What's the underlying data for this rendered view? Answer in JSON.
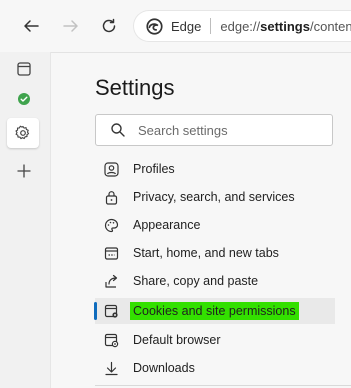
{
  "browser": {
    "brand": "Edge",
    "url_prefix": "edge://",
    "url_bold": "settings",
    "url_suffix": "/content"
  },
  "settings": {
    "title": "Settings",
    "search_placeholder": "Search settings",
    "nav": [
      {
        "label": "Profiles",
        "icon": "profile-icon"
      },
      {
        "label": "Privacy, search, and services",
        "icon": "lock-icon"
      },
      {
        "label": "Appearance",
        "icon": "appearance-icon"
      },
      {
        "label": "Start, home, and new tabs",
        "icon": "start-icon"
      },
      {
        "label": "Share, copy and paste",
        "icon": "share-icon"
      },
      {
        "label": "Cookies and site permissions",
        "icon": "cookies-icon",
        "active": true
      },
      {
        "label": "Default browser",
        "icon": "default-browser-icon"
      },
      {
        "label": "Downloads",
        "icon": "download-icon"
      }
    ]
  },
  "colors": {
    "highlight": "#33e000",
    "accent": "#0f6cbd"
  }
}
